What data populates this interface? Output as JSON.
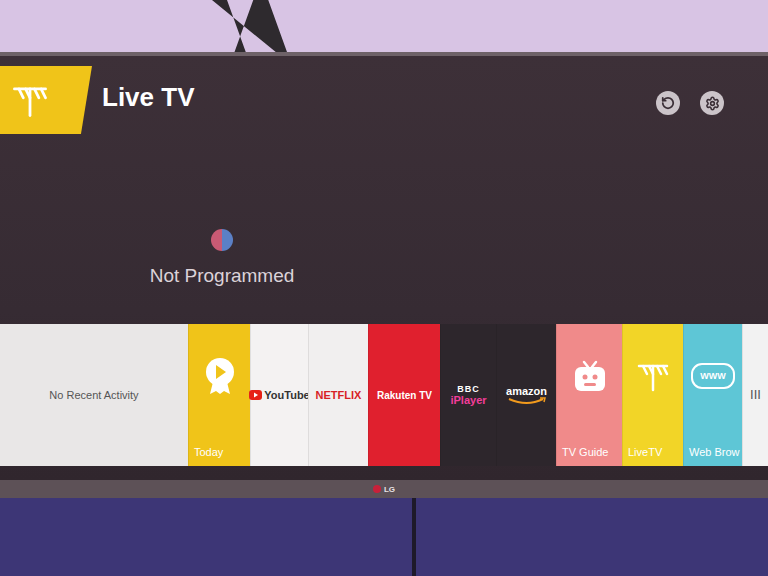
{
  "header": {
    "title": "Live TV"
  },
  "status": {
    "text": "Not Programmed"
  },
  "recent": {
    "text": "No Recent Activity"
  },
  "apps": [
    {
      "kind": "today",
      "label": "Today",
      "prefix": "",
      "color": "#f0c419",
      "text_color": "#ffffff"
    },
    {
      "kind": "playlogo",
      "label": "YouTube",
      "prefix": "",
      "color": "#f4f2f2",
      "text_color": "#333333"
    },
    {
      "kind": "logo",
      "label": "NETFLIX",
      "prefix": "",
      "color": "#f1efef",
      "text_color": "#d81f26"
    },
    {
      "kind": "logo",
      "label": "Rakuten TV",
      "prefix": "",
      "color": "#e0202e",
      "text_color": "#ffffff"
    },
    {
      "kind": "stacked",
      "label": "iPlayer",
      "prefix": "BBC",
      "color": "#2d262c",
      "text_color": "#f23d9a"
    },
    {
      "kind": "smile",
      "label": "amazon",
      "prefix": "",
      "color": "#2d262c",
      "text_color": "#ffffff"
    },
    {
      "kind": "guide",
      "label": "TV Guide",
      "prefix": "",
      "color": "#f08a8a",
      "text_color": "#ffffff"
    },
    {
      "kind": "antenna",
      "label": "LiveTV",
      "prefix": "",
      "color": "#f2d527",
      "text_color": "#ffffff"
    },
    {
      "kind": "browser",
      "label": "Web Brow",
      "prefix": "WWW",
      "color": "#5ec6d6",
      "text_color": "#ffffff"
    },
    {
      "kind": "more",
      "label": "III",
      "prefix": "",
      "color": "#f2f2f2",
      "text_color": "#555555"
    }
  ],
  "brand": "LG"
}
